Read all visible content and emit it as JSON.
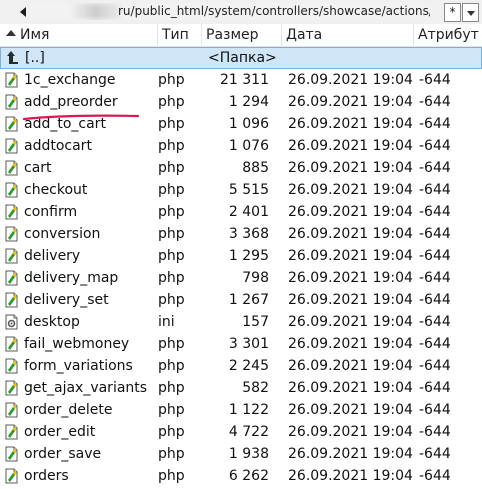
{
  "pathbar": {
    "path": "ru/public_html/system/controllers/showcase/actions/*.*",
    "star_label": "*"
  },
  "columns": {
    "name": "Имя",
    "type": "Тип",
    "size": "Размер",
    "date": "Дата",
    "attr": "Атрибут"
  },
  "parent_row": {
    "name": "[..]",
    "label": "<Папка>"
  },
  "files": [
    {
      "name": "1c_exchange",
      "type": "php",
      "size": "21 311",
      "date": "26.09.2021 19:04",
      "attr": "-644",
      "icon": "php-file-icon"
    },
    {
      "name": "add_preorder",
      "type": "php",
      "size": "1 294",
      "date": "26.09.2021 19:04",
      "attr": "-644",
      "icon": "php-file-icon"
    },
    {
      "name": "add_to_cart",
      "type": "php",
      "size": "1 096",
      "date": "26.09.2021 19:04",
      "attr": "-644",
      "icon": "php-file-icon"
    },
    {
      "name": "addtocart",
      "type": "php",
      "size": "1 076",
      "date": "26.09.2021 19:04",
      "attr": "-644",
      "icon": "php-file-icon"
    },
    {
      "name": "cart",
      "type": "php",
      "size": "885",
      "date": "26.09.2021 19:04",
      "attr": "-644",
      "icon": "php-file-icon"
    },
    {
      "name": "checkout",
      "type": "php",
      "size": "5 515",
      "date": "26.09.2021 19:04",
      "attr": "-644",
      "icon": "php-file-icon"
    },
    {
      "name": "confirm",
      "type": "php",
      "size": "2 401",
      "date": "26.09.2021 19:04",
      "attr": "-644",
      "icon": "php-file-icon"
    },
    {
      "name": "conversion",
      "type": "php",
      "size": "3 368",
      "date": "26.09.2021 19:04",
      "attr": "-644",
      "icon": "php-file-icon"
    },
    {
      "name": "delivery",
      "type": "php",
      "size": "1 295",
      "date": "26.09.2021 19:04",
      "attr": "-644",
      "icon": "php-file-icon"
    },
    {
      "name": "delivery_map",
      "type": "php",
      "size": "798",
      "date": "26.09.2021 19:04",
      "attr": "-644",
      "icon": "php-file-icon"
    },
    {
      "name": "delivery_set",
      "type": "php",
      "size": "1 267",
      "date": "26.09.2021 19:04",
      "attr": "-644",
      "icon": "php-file-icon"
    },
    {
      "name": "desktop",
      "type": "ini",
      "size": "157",
      "date": "26.09.2021 19:04",
      "attr": "-644",
      "icon": "ini-file-icon"
    },
    {
      "name": "fail_webmoney",
      "type": "php",
      "size": "3 301",
      "date": "26.09.2021 19:04",
      "attr": "-644",
      "icon": "php-file-icon"
    },
    {
      "name": "form_variations",
      "type": "php",
      "size": "2 245",
      "date": "26.09.2021 19:04",
      "attr": "-644",
      "icon": "php-file-icon"
    },
    {
      "name": "get_ajax_variants",
      "type": "php",
      "size": "582",
      "date": "26.09.2021 19:04",
      "attr": "-644",
      "icon": "php-file-icon"
    },
    {
      "name": "order_delete",
      "type": "php",
      "size": "1 122",
      "date": "26.09.2021 19:04",
      "attr": "-644",
      "icon": "php-file-icon"
    },
    {
      "name": "order_edit",
      "type": "php",
      "size": "4 722",
      "date": "26.09.2021 19:04",
      "attr": "-644",
      "icon": "php-file-icon"
    },
    {
      "name": "order_save",
      "type": "php",
      "size": "1 938",
      "date": "26.09.2021 19:04",
      "attr": "-644",
      "icon": "php-file-icon"
    },
    {
      "name": "orders",
      "type": "php",
      "size": "6 262",
      "date": "26.09.2021 19:04",
      "attr": "-644",
      "icon": "php-file-icon"
    }
  ],
  "colors": {
    "selection": "#cfe6f8",
    "selection_border": "#7ab1dc",
    "annotation": "#e0154f"
  }
}
